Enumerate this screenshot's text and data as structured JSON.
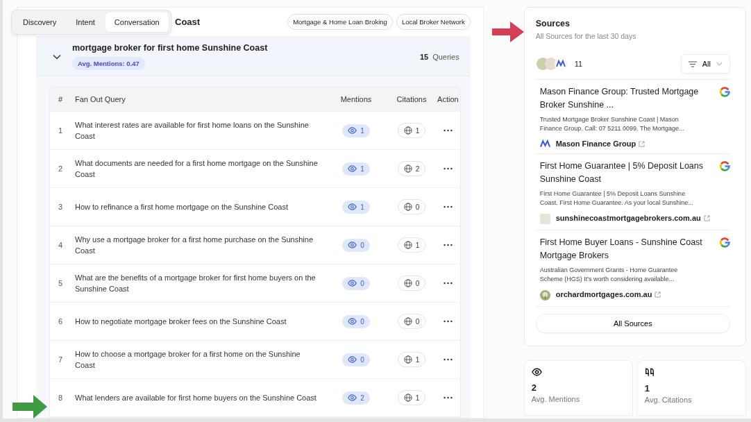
{
  "tabs": [
    {
      "label": "Discovery",
      "selected": false
    },
    {
      "label": "Intent",
      "selected": false
    },
    {
      "label": "Conversation",
      "selected": true
    }
  ],
  "header": {
    "title": "Coast",
    "tags": [
      "Mortgage & Home Loan Broking",
      "Local Broker Network"
    ]
  },
  "group": {
    "title": "mortgage broker for first home Sunshine Coast",
    "expanded": true,
    "avg_label": "Avg. Mentions:",
    "avg_value": "0.47",
    "count": "15",
    "count_label": "Queries"
  },
  "table": {
    "columns": [
      "#",
      "Fan Out Query",
      "Mentions",
      "Citations",
      "Action"
    ],
    "rows": [
      {
        "num": "1",
        "query": "What interest rates are available for first home loans on the Sunshine Coast",
        "mentions": "1",
        "citations": "1"
      },
      {
        "num": "2",
        "query": "What documents are needed for a first home mortgage on the Sunshine Coast",
        "mentions": "1",
        "citations": "2"
      },
      {
        "num": "3",
        "query": "How to refinance a first home mortgage on the Sunshine Coast",
        "mentions": "1",
        "citations": "0"
      },
      {
        "num": "4",
        "query": "Why use a mortgage broker for a first home purchase on the Sunshine Coast",
        "mentions": "0",
        "citations": "1"
      },
      {
        "num": "5",
        "query": "What are the benefits of a mortgage broker for first home buyers on the Sunshine Coast",
        "mentions": "0",
        "citations": "0"
      },
      {
        "num": "6",
        "query": "How to negotiate mortgage broker fees on the Sunshine Coast",
        "mentions": "0",
        "citations": "0"
      },
      {
        "num": "7",
        "query": "How to choose a mortgage broker for a first home on the Sunshine Coast",
        "mentions": "0",
        "citations": "1"
      },
      {
        "num": "8",
        "query": "What lenders are available for first home buyers on the Sunshine Coast",
        "mentions": "2",
        "citations": "1"
      }
    ]
  },
  "sources": {
    "title": "Sources",
    "subtitle": "All Sources for the last 30 days",
    "count": "11",
    "filter": "All",
    "items": [
      {
        "title": "Mason Finance Group: Trusted Mortgage Broker Sunshine ...",
        "snippet": "Trusted Mortgage Broker Sunshine Coast | Mason Finance Group. Call: 07 5211 0099. The Mortgage...",
        "site": "Mason Finance Group",
        "kind": "letters"
      },
      {
        "title": "First Home Guarantee | 5% Deposit Loans Sunshine Coast",
        "snippet": "First Home Guarantee | 5% Deposit Loans Sunshine Coast. First Home Guarantee. As your local Sunshine...",
        "site": "sunshinecoastmortgagebrokers.com.au",
        "kind": "square"
      },
      {
        "title": "First Home Buyer Loans - Sunshine Coast Mortgage Brokers",
        "snippet": "Australian Government Grants - Home Guarantee Scheme (HGS) It's worth considering available...",
        "site": "orchardmortgages.com.au",
        "kind": "tree"
      }
    ],
    "button": "All Sources"
  },
  "stats": [
    {
      "kind": "mentions",
      "value": "2",
      "label": "Avg. Mentions"
    },
    {
      "kind": "citations",
      "value": "1",
      "label": "Avg. Citations"
    }
  ]
}
